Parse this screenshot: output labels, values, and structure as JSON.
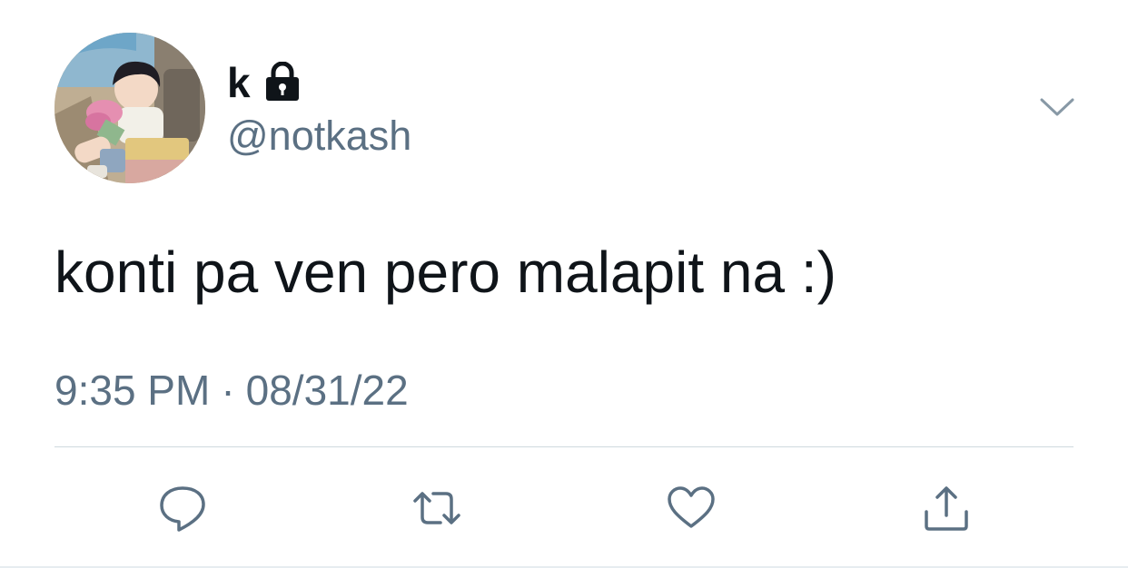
{
  "tweet": {
    "display_name": "k",
    "handle": "@notkash",
    "protected_icon": "lock-icon",
    "text": "konti pa ven pero malapit na :)",
    "time": "9:35 PM",
    "separator": "·",
    "date": "08/31/22"
  },
  "actions": {
    "reply_icon": "reply-icon",
    "retweet_icon": "retweet-icon",
    "like_icon": "heart-icon",
    "share_icon": "share-icon"
  },
  "colors": {
    "text_primary": "#0f1419",
    "text_secondary": "#5b7083",
    "icon": "#5b7083",
    "divider": "#cfd9de"
  }
}
